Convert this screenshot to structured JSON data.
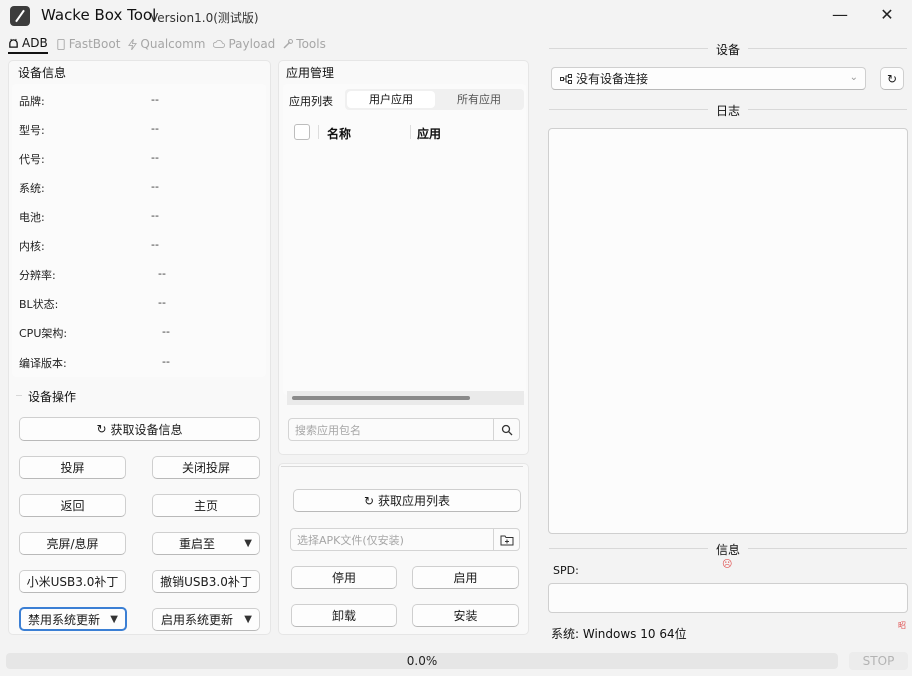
{
  "window": {
    "title": "Wacke Box Tool",
    "version": "Version1.0(测试版)",
    "minimize": "—",
    "close": "✕"
  },
  "tabs": [
    {
      "label": "ADB",
      "icon": "android-icon"
    },
    {
      "label": "FastBoot",
      "icon": "phone-icon"
    },
    {
      "label": "Qualcomm",
      "icon": "bolt-icon"
    },
    {
      "label": "Payload",
      "icon": "cloud-icon"
    },
    {
      "label": "Tools",
      "icon": "wrench-icon"
    }
  ],
  "device_info": {
    "title": "设备信息",
    "rows": [
      {
        "label": "品牌:",
        "value": "--"
      },
      {
        "label": "型号:",
        "value": "--"
      },
      {
        "label": "代号:",
        "value": "--"
      },
      {
        "label": "系统:",
        "value": "--"
      },
      {
        "label": "电池:",
        "value": "--"
      },
      {
        "label": "内核:",
        "value": "--"
      },
      {
        "label": "分辨率:",
        "value": "--"
      },
      {
        "label": "BL状态:",
        "value": "--"
      },
      {
        "label": "CPU架构:",
        "value": "--"
      },
      {
        "label": "编译版本:",
        "value": "--"
      }
    ]
  },
  "device_ops": {
    "title": "设备操作",
    "get_info": "获取设备信息",
    "buttons": {
      "screen_cast": "投屏",
      "close_cast": "关闭投屏",
      "back": "返回",
      "home": "主页",
      "wake": "亮屏/息屏",
      "reboot_to": "重启至",
      "mi_usb": "小米USB3.0补丁",
      "undo_usb": "撤销USB3.0补丁",
      "disable_update": "禁用系统更新",
      "enable_update": "启用系统更新"
    }
  },
  "app_mgmt": {
    "title": "应用管理",
    "list_label": "应用列表",
    "seg_user": "用户应用",
    "seg_all": "所有应用",
    "col_name": "名称",
    "col_app": "应用",
    "search_placeholder": "搜索应用包名",
    "get_list": "获取应用列表",
    "apk_placeholder": "选择APK文件(仅安装)",
    "disable": "停用",
    "enable": "启用",
    "uninstall": "卸载",
    "install": "安装"
  },
  "right": {
    "device_title": "设备",
    "device_select": "没有设备连接",
    "log_title": "日志",
    "info_title": "信息",
    "spd_label": "SPD:",
    "system_text": "系统: Windows 10 64位",
    "warn_glyph": "☹",
    "corner_mark": "昭"
  },
  "footer": {
    "progress_text": "0.0%",
    "progress_value": 0,
    "stop": "STOP"
  },
  "colors": {
    "accent": "#3b7fd4",
    "warn": "#e05050"
  }
}
